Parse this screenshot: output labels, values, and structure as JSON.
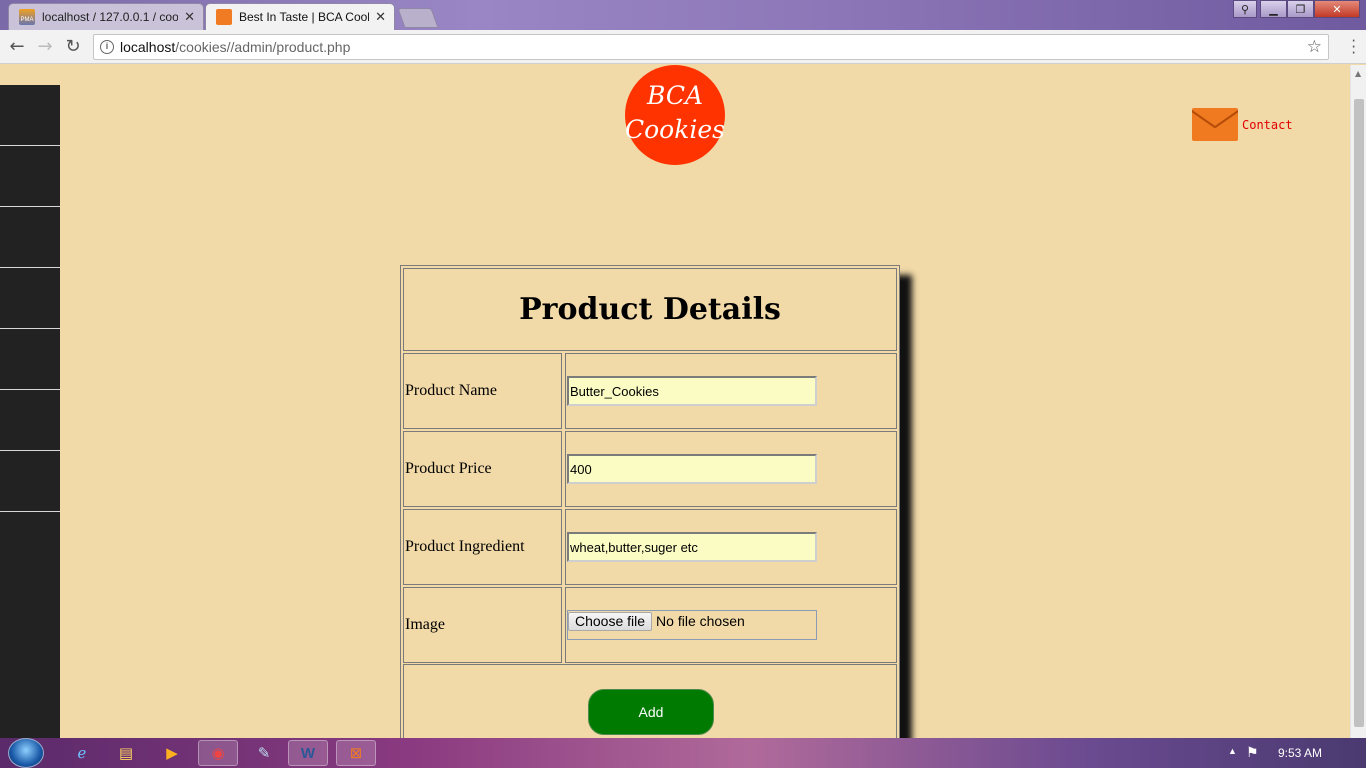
{
  "browser": {
    "tabs": [
      {
        "title": "localhost / 127.0.0.1 / coo",
        "favicon": "phpmyadmin-icon",
        "active": false
      },
      {
        "title": "Best In Taste | BCA Cookie",
        "favicon": "xampp-icon",
        "active": true
      }
    ],
    "address": {
      "host": "localhost",
      "path": "/cookies//admin/product.php"
    }
  },
  "page": {
    "logo_line1": "BCA",
    "logo_line2": "Cookies",
    "contact_label": "Contact",
    "sidebar_items": 7,
    "form": {
      "heading": "Product Details",
      "rows": [
        {
          "label": "Product Name",
          "value": "Butter_Cookies"
        },
        {
          "label": "Product Price",
          "value": "400"
        },
        {
          "label": "Product Ingredient",
          "value": "wheat,butter,suger etc"
        }
      ],
      "image_label": "Image",
      "file_button": "Choose file",
      "file_status": "No file chosen",
      "submit_label": "Add"
    }
  },
  "taskbar": {
    "clock": "9:53 AM"
  },
  "colors": {
    "page_bg": "#f1d9a8",
    "logo_bg": "#ff3300",
    "contact_text": "#e00000",
    "input_bg": "#fafcc4",
    "add_button": "#007a00",
    "sidebar": "#222222"
  }
}
